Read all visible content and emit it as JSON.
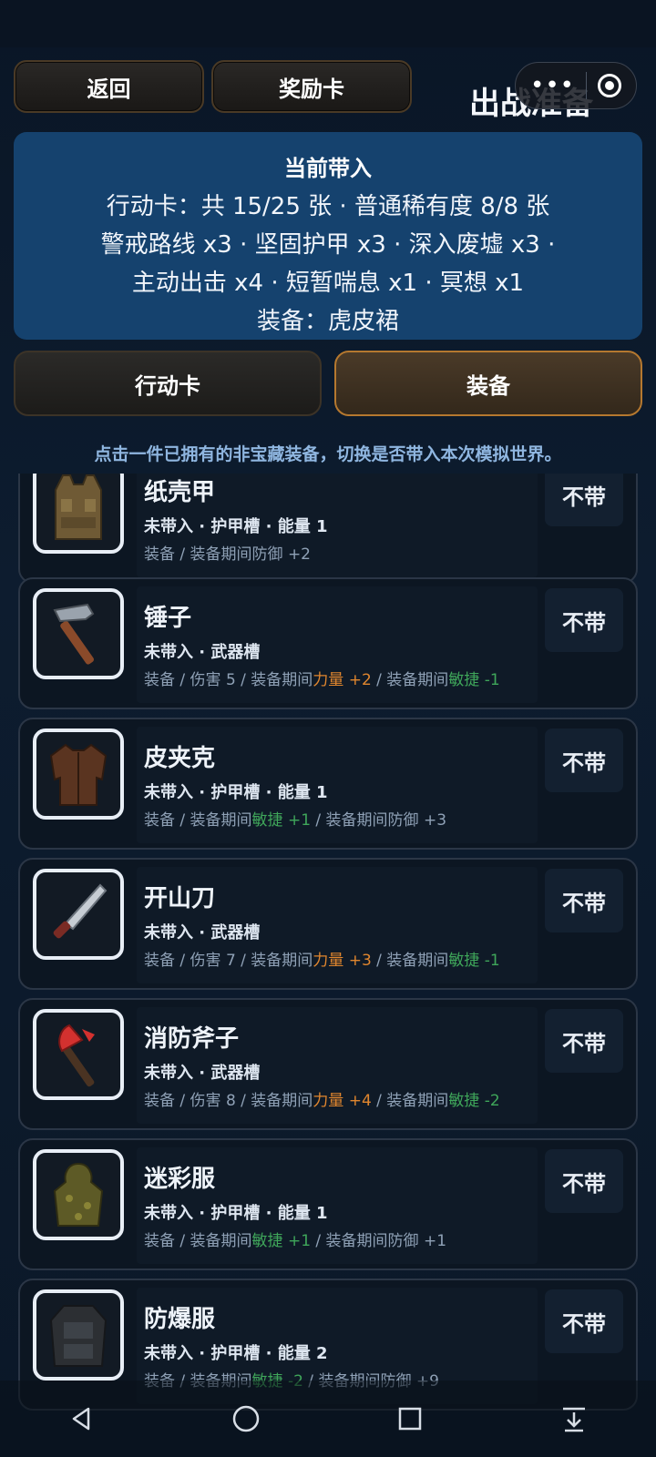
{
  "header": {
    "back_label": "返回",
    "reward_label": "奖励卡",
    "title": "出战准备",
    "capsule_dots": "•••"
  },
  "info": {
    "heading": "当前带入",
    "line1": "行动卡：共 15/25 张 · 普通稀有度 8/8 张",
    "line2": "警戒路线 x3 · 坚固护甲 x3 · 深入废墟 x3 ·",
    "line3": "主动出击 x4 · 短暂喘息 x1 · 冥想 x1",
    "line4": "装备：虎皮裙"
  },
  "tabs": {
    "action_cards": "行动卡",
    "equipment": "装备",
    "active": "equipment"
  },
  "hint": "点击一件已拥有的非宝藏装备，切换是否带入本次模拟世界。",
  "items": [
    {
      "name": "纸壳甲",
      "meta": "未带入 · 护甲槽 · 能量 1",
      "d1": "装备 / 装备期间防御 +2",
      "d2": "",
      "d3": "",
      "d4": "",
      "d5": "",
      "action": "不带",
      "rarity": "white",
      "icon": "vest-icon"
    },
    {
      "name": "锤子",
      "meta": "未带入 · 武器槽",
      "d1": "装备 / 伤害 5 / 装备期间",
      "d2": "力量 +2",
      "d3": " / 装备期间",
      "d4": "敏捷 -1",
      "d5": "",
      "action": "不带",
      "rarity": "green",
      "icon": "hammer-icon"
    },
    {
      "name": "皮夹克",
      "meta": "未带入 · 护甲槽 · 能量 1",
      "d1": "装备 / 装备期间",
      "d2": "",
      "d3": "",
      "d4": "敏捷 +1",
      "d5": " / 装备期间防御 +3",
      "action": "不带",
      "rarity": "green",
      "icon": "jacket-icon"
    },
    {
      "name": "开山刀",
      "meta": "未带入 · 武器槽",
      "d1": "装备 / 伤害 7 / 装备期间",
      "d2": "力量 +3",
      "d3": " / 装备期间",
      "d4": "敏捷 -1",
      "d5": "",
      "action": "不带",
      "rarity": "blue",
      "icon": "machete-icon"
    },
    {
      "name": "消防斧子",
      "meta": "未带入 · 武器槽",
      "d1": "装备 / 伤害 8 / 装备期间",
      "d2": "力量 +4",
      "d3": " / 装备期间",
      "d4": "敏捷 -2",
      "d5": "",
      "action": "不带",
      "rarity": "blue",
      "icon": "fire-axe-icon"
    },
    {
      "name": "迷彩服",
      "meta": "未带入 · 护甲槽 · 能量 1",
      "d1": "装备 / 装备期间",
      "d2": "",
      "d3": "",
      "d4": "敏捷 +1",
      "d5": " / 装备期间防御 +1",
      "action": "不带",
      "rarity": "purple",
      "icon": "ghillie-suit-icon"
    },
    {
      "name": "防爆服",
      "meta": "未带入 · 护甲槽 · 能量 2",
      "d1": "装备 / 装备期间",
      "d2": "",
      "d3": "",
      "d4": "敏捷 -2",
      "d5": " / 装备期间防御 +9",
      "action": "不带",
      "rarity": "orange",
      "icon": "bomb-suit-icon"
    }
  ],
  "nav": [
    "back-icon",
    "home-icon",
    "recents-icon",
    "drawer-icon"
  ],
  "colors": {
    "panel": "#15426e",
    "active_tab_border": "#b5782f",
    "strength": "#e0862e",
    "agility": "#3fa65a",
    "hint": "#8fb6e0"
  }
}
